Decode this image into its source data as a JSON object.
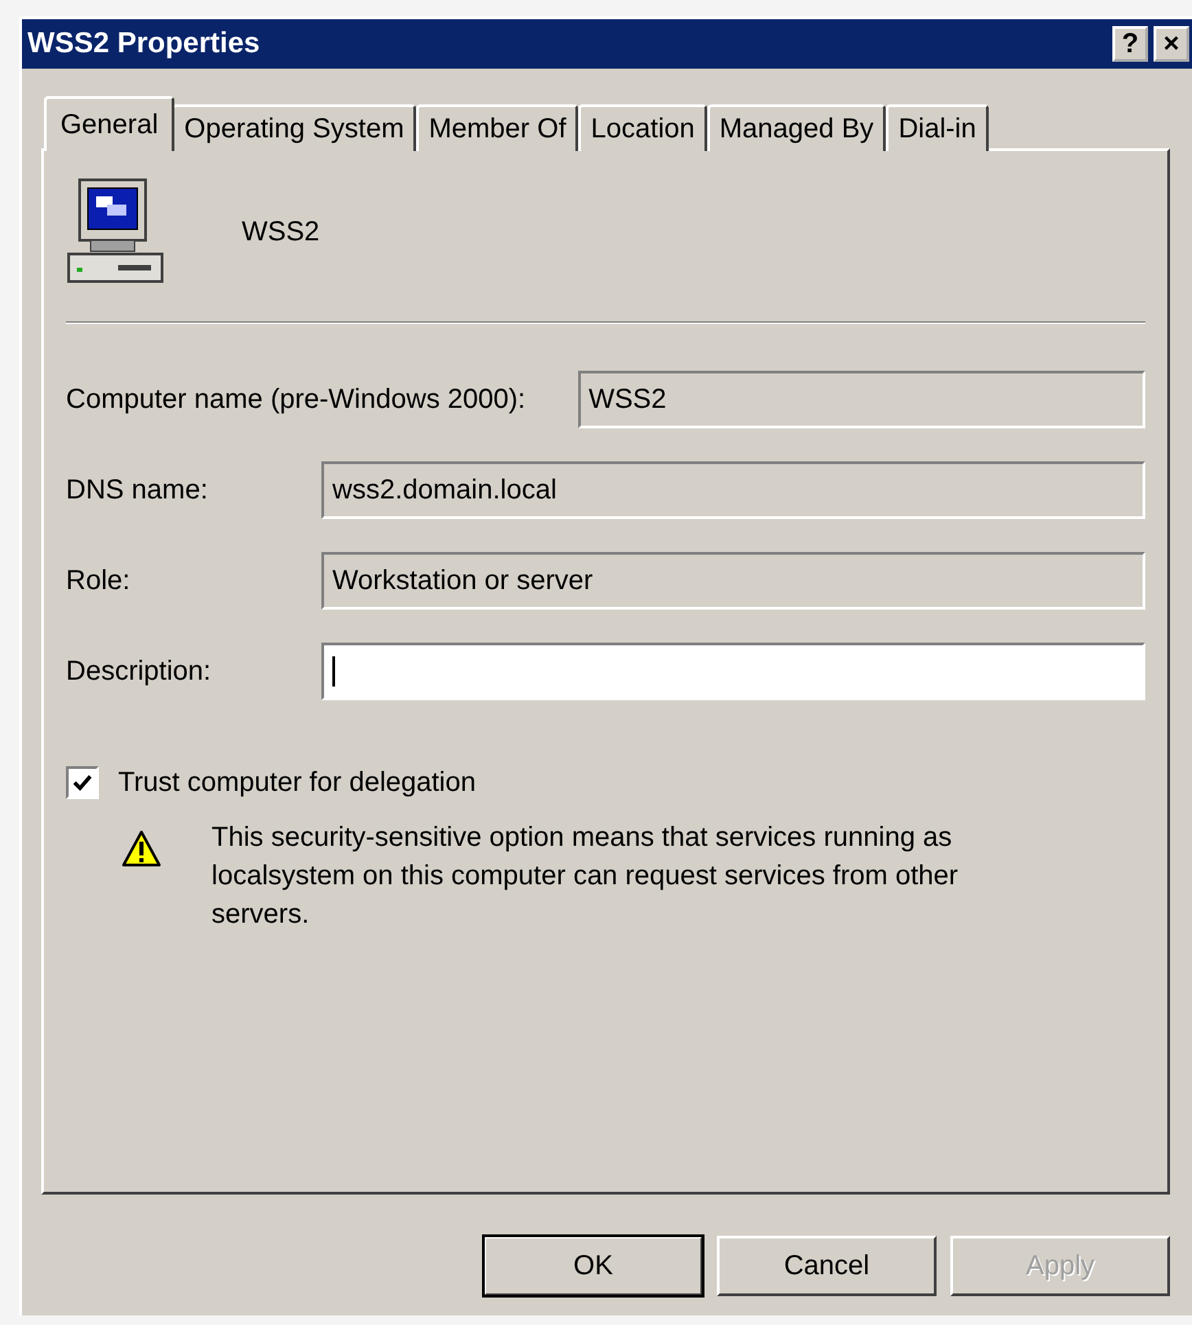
{
  "window": {
    "title": "WSS2 Properties",
    "title_buttons": [
      "?",
      "×"
    ]
  },
  "tabs": [
    {
      "label": "General",
      "selected": true
    },
    {
      "label": "Operating System",
      "selected": false
    },
    {
      "label": "Member Of",
      "selected": false
    },
    {
      "label": "Location",
      "selected": false
    },
    {
      "label": "Managed By",
      "selected": false
    },
    {
      "label": "Dial-in",
      "selected": false
    }
  ],
  "header": {
    "name": "WSS2"
  },
  "fields": [
    {
      "label": "Computer name (pre-Windows 2000):",
      "value": "WSS2",
      "readonly": true
    },
    {
      "label": "DNS name:",
      "value": "wss2.domain.local",
      "readonly": true
    },
    {
      "label": "Role:",
      "value": "Workstation or server",
      "readonly": true
    },
    {
      "label": "Description:",
      "readonly": false
    }
  ],
  "delegation": {
    "label": "Trust computer for delegation",
    "checked": true
  },
  "warning": "This security-sensitive option means that services running as localsystem on this computer can request services from other servers.",
  "buttons": [
    {
      "label": "OK",
      "default": true,
      "disabled": false
    },
    {
      "label": "Cancel",
      "default": false,
      "disabled": false
    },
    {
      "label": "Apply",
      "default": false,
      "disabled": true
    }
  ]
}
